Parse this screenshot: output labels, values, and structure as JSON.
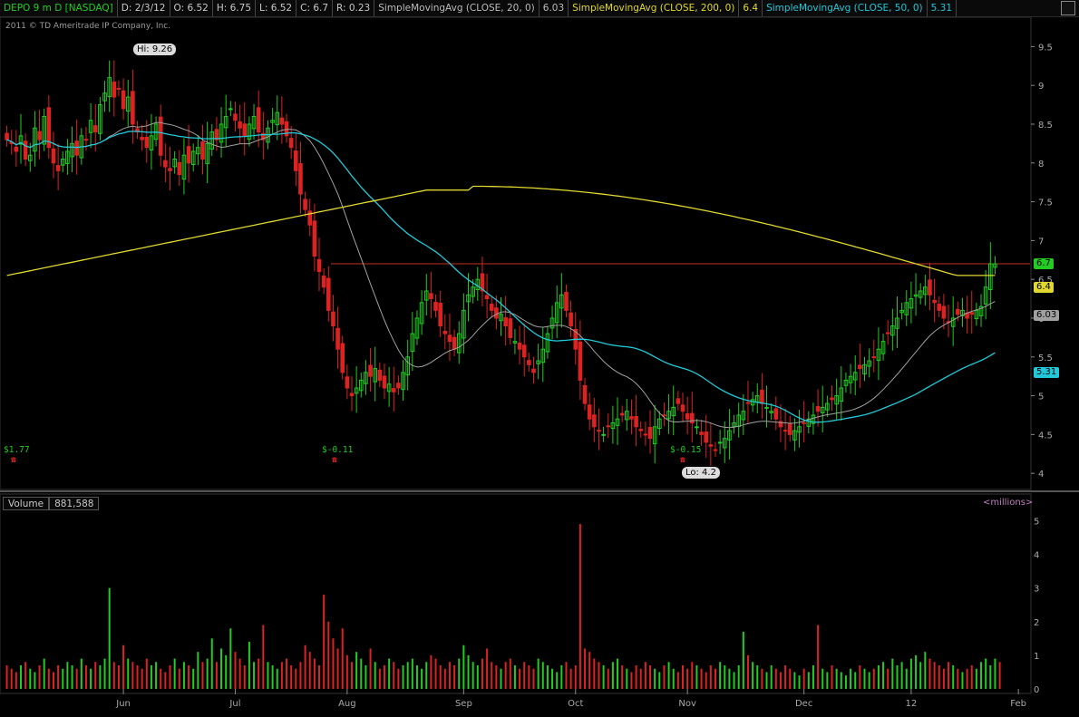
{
  "header": {
    "symbol": "DEPO 9 m D [NASDAQ]",
    "date": "D: 2/3/12",
    "open": "O: 6.52",
    "high": "H: 6.75",
    "low": "L: 6.52",
    "close": "C: 6.7",
    "range": "R: 0.23",
    "sma20_label": "SimpleMovingAvg (CLOSE, 20, 0)",
    "sma20_value": "6.03",
    "sma200_label": "SimpleMovingAvg (CLOSE, 200, 0)",
    "sma200_value": "6.4",
    "sma50_label": "SimpleMovingAvg (CLOSE, 50, 0)",
    "sma50_value": "5.31"
  },
  "copyright": "2011 © TD Ameritrade IP Company, Inc.",
  "volume_panel": {
    "label": "Volume",
    "value": "881,588",
    "units": "<millions>"
  },
  "annotations": {
    "hi": "Hi: 9.26",
    "lo": "Lo: 4.2",
    "e1": "$1.77",
    "e2": "$-0.11",
    "e3": "$-0.15"
  },
  "price_tags": {
    "close": "6.7",
    "sma200": "6.4",
    "sma20": "6.03",
    "sma50": "5.31"
  },
  "colors": {
    "up": "#22cc22",
    "down": "#dd2222",
    "sma20": "#a0a0a0",
    "sma50": "#22c8d8",
    "sma200": "#e0d830",
    "hline": "#c03020"
  },
  "chart_data": {
    "type": "candlestick",
    "y_ticks": [
      "9.5",
      "9",
      "8.5",
      "8",
      "7.5",
      "7",
      "6.5",
      "6",
      "5.5",
      "5",
      "4.5",
      "4"
    ],
    "ylim": [
      3.85,
      9.75
    ],
    "volume_ticks": [
      "5",
      "4",
      "3",
      "2",
      "1",
      "0"
    ],
    "volume_ylim": [
      0,
      5.2
    ],
    "x_labels": [
      "Jun",
      "Jul",
      "Aug",
      "Sep",
      "Oct",
      "Nov",
      "Dec",
      "12",
      "Feb"
    ],
    "x_label_days": [
      25,
      49,
      73,
      98,
      122,
      146,
      171,
      194,
      217
    ],
    "days": 220,
    "horizontal_line": 6.7,
    "close": [
      8.3,
      8.25,
      8.15,
      8.35,
      8.05,
      8.1,
      8.45,
      8.3,
      8.6,
      8.2,
      8.0,
      7.9,
      8.05,
      8.15,
      8.25,
      8.1,
      8.35,
      8.3,
      8.55,
      8.4,
      8.75,
      8.9,
      9.1,
      8.85,
      8.95,
      8.7,
      8.85,
      8.5,
      8.4,
      8.3,
      8.2,
      8.35,
      8.5,
      8.1,
      7.95,
      7.9,
      8.05,
      7.85,
      8.1,
      8.0,
      8.15,
      8.2,
      8.05,
      8.25,
      8.4,
      8.3,
      8.5,
      8.6,
      8.7,
      8.55,
      8.45,
      8.35,
      8.5,
      8.6,
      8.4,
      8.3,
      8.45,
      8.55,
      8.65,
      8.5,
      8.35,
      8.2,
      7.9,
      7.6,
      7.4,
      7.2,
      6.8,
      6.6,
      6.4,
      6.1,
      5.9,
      5.6,
      5.3,
      5.1,
      5.0,
      5.1,
      5.2,
      5.3,
      5.25,
      5.35,
      5.2,
      5.1,
      5.15,
      5.05,
      5.1,
      5.3,
      5.5,
      5.8,
      6.0,
      6.2,
      6.35,
      6.25,
      6.1,
      5.9,
      5.8,
      5.7,
      5.6,
      5.8,
      6.1,
      6.3,
      6.4,
      6.5,
      6.35,
      6.25,
      6.1,
      6.0,
      6.05,
      5.9,
      5.75,
      5.7,
      5.6,
      5.5,
      5.4,
      5.3,
      5.45,
      5.6,
      5.8,
      6.0,
      6.2,
      6.3,
      6.1,
      5.9,
      5.6,
      5.2,
      4.9,
      4.7,
      4.6,
      4.55,
      4.5,
      4.6,
      4.65,
      4.7,
      4.75,
      4.8,
      4.7,
      4.6,
      4.55,
      4.5,
      4.45,
      4.6,
      4.7,
      4.75,
      4.8,
      4.85,
      4.9,
      4.8,
      4.7,
      4.65,
      4.6,
      4.5,
      4.4,
      4.35,
      4.3,
      4.4,
      4.45,
      4.55,
      4.65,
      4.75,
      4.8,
      4.9,
      4.95,
      5.0,
      4.9,
      4.85,
      4.8,
      4.7,
      4.6,
      4.55,
      4.5,
      4.55,
      4.6,
      4.65,
      4.7,
      4.75,
      4.8,
      4.85,
      4.9,
      4.95,
      5.0,
      5.1,
      5.2,
      5.25,
      5.3,
      5.35,
      5.4,
      5.45,
      5.5,
      5.6,
      5.7,
      5.8,
      5.9,
      6.0,
      6.1,
      6.2,
      6.25,
      6.3,
      6.35,
      6.4,
      6.3,
      6.2,
      6.1,
      6.0,
      5.95,
      6.0,
      6.05,
      6.1,
      6.0,
      6.05,
      6.1,
      6.15,
      6.4,
      6.7,
      6.7
    ],
    "sma20_last": 6.03,
    "sma50_last": 5.31,
    "sma200_last": 6.4,
    "volume": [
      0.7,
      0.6,
      0.5,
      0.7,
      0.8,
      0.6,
      0.5,
      0.7,
      0.9,
      0.6,
      0.5,
      0.7,
      0.6,
      0.8,
      0.7,
      0.6,
      0.9,
      0.7,
      0.6,
      0.8,
      0.7,
      0.9,
      3.0,
      0.8,
      0.7,
      1.3,
      0.9,
      0.8,
      0.7,
      0.6,
      0.9,
      0.7,
      0.8,
      0.6,
      0.5,
      0.7,
      0.9,
      0.6,
      0.8,
      0.7,
      0.6,
      1.1,
      0.8,
      0.9,
      1.5,
      0.8,
      1.2,
      1.0,
      1.8,
      1.1,
      0.9,
      0.7,
      1.4,
      0.8,
      0.9,
      1.9,
      0.8,
      0.7,
      0.6,
      0.8,
      0.9,
      0.7,
      0.6,
      0.8,
      1.3,
      1.1,
      0.9,
      0.7,
      2.8,
      2.0,
      1.5,
      1.2,
      1.8,
      1.0,
      0.8,
      1.1,
      0.9,
      0.7,
      1.2,
      0.8,
      0.6,
      0.7,
      0.9,
      0.8,
      0.6,
      0.7,
      0.8,
      0.9,
      0.7,
      0.6,
      0.8,
      1.0,
      0.9,
      0.7,
      0.6,
      0.8,
      0.7,
      0.9,
      1.3,
      1.0,
      0.8,
      0.7,
      0.9,
      1.2,
      0.8,
      0.7,
      0.6,
      0.8,
      0.9,
      0.7,
      0.6,
      0.8,
      0.7,
      0.6,
      0.9,
      0.8,
      0.7,
      0.6,
      0.5,
      0.7,
      0.8,
      0.6,
      0.7,
      4.9,
      1.2,
      1.1,
      0.9,
      0.8,
      0.7,
      0.6,
      0.8,
      0.9,
      0.7,
      0.6,
      0.5,
      0.7,
      0.6,
      0.8,
      0.7,
      0.6,
      0.5,
      0.7,
      0.8,
      0.6,
      0.5,
      0.7,
      0.6,
      0.8,
      0.7,
      0.6,
      0.5,
      0.7,
      0.6,
      0.8,
      0.7,
      0.6,
      0.5,
      0.7,
      1.7,
      1.0,
      0.8,
      0.7,
      0.6,
      0.5,
      0.7,
      0.6,
      0.5,
      0.7,
      0.6,
      0.5,
      0.4,
      0.6,
      0.5,
      0.7,
      1.9,
      0.6,
      0.5,
      0.7,
      0.6,
      0.5,
      0.4,
      0.6,
      0.5,
      0.7,
      0.6,
      0.5,
      0.6,
      0.7,
      0.8,
      0.6,
      0.9,
      0.7,
      0.8,
      0.6,
      0.9,
      1.0,
      0.8,
      1.1,
      0.9,
      0.8,
      0.7,
      0.6,
      0.8,
      0.7,
      0.6,
      0.5,
      0.6,
      0.7,
      0.6,
      0.8,
      0.9,
      0.7,
      0.9,
      0.8
    ]
  }
}
